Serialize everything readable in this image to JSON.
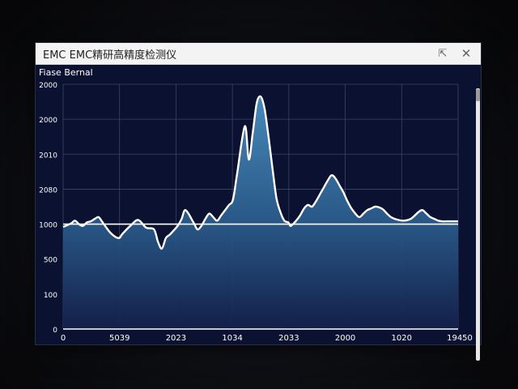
{
  "window": {
    "title": "EMC EMC精研高精度检测仪",
    "restore_glyph": "⇱",
    "close_glyph": "✕"
  },
  "chart_data": {
    "type": "area",
    "title": "Fiase Bernal",
    "xlabel": "",
    "ylabel": "",
    "x_tick_labels": [
      "0",
      "5039",
      "2023",
      "1034",
      "2033",
      "2000",
      "1020",
      "19450"
    ],
    "y_tick_labels": [
      "0",
      "100",
      "500",
      "1000",
      "2080",
      "2010",
      "2000",
      "2000"
    ],
    "ylim": [
      0,
      7
    ],
    "xlim": [
      0,
      100
    ],
    "reference_line": 3,
    "grid": true,
    "colors": {
      "line": "#ffffff",
      "fill_top": "#3f7fb0",
      "fill_bottom": "#13204a",
      "grid": "#3a4468",
      "axis_text": "#ffffff"
    },
    "x": [
      0,
      2,
      3,
      4,
      5,
      6,
      7,
      8,
      9,
      10,
      12,
      14,
      15,
      17,
      19,
      21,
      23,
      24,
      25,
      26,
      27,
      28,
      29,
      30,
      31,
      33,
      34,
      35,
      36,
      37,
      38,
      39,
      40,
      41,
      42,
      43,
      44,
      46,
      47,
      48,
      49,
      50,
      51,
      52,
      53,
      54,
      55,
      56,
      57,
      57.5,
      58,
      59,
      60,
      61,
      62,
      63,
      64,
      65,
      66,
      67,
      68,
      69,
      70,
      71,
      72,
      73,
      74,
      75,
      76,
      77,
      78,
      79,
      80,
      81,
      82,
      83,
      84,
      86,
      88,
      90,
      91,
      92,
      93,
      94,
      95,
      96,
      97,
      98,
      99,
      100
    ],
    "y": [
      2.92,
      3.02,
      3.1,
      3.0,
      2.95,
      3.05,
      3.08,
      3.15,
      3.2,
      3.05,
      2.75,
      2.6,
      2.72,
      2.95,
      3.12,
      2.9,
      2.85,
      2.5,
      2.3,
      2.6,
      2.7,
      2.82,
      2.95,
      3.15,
      3.4,
      3.05,
      2.85,
      2.95,
      3.15,
      3.3,
      3.2,
      3.1,
      3.25,
      3.4,
      3.55,
      3.7,
      4.4,
      5.8,
      4.85,
      5.6,
      6.45,
      6.65,
      6.3,
      5.5,
      4.6,
      3.75,
      3.35,
      3.1,
      3.05,
      2.95,
      2.98,
      3.1,
      3.25,
      3.45,
      3.55,
      3.5,
      3.65,
      3.85,
      4.05,
      4.25,
      4.4,
      4.3,
      4.1,
      3.9,
      3.65,
      3.45,
      3.3,
      3.2,
      3.3,
      3.4,
      3.45,
      3.5,
      3.48,
      3.42,
      3.3,
      3.2,
      3.15,
      3.1,
      3.15,
      3.35,
      3.4,
      3.3,
      3.2,
      3.15,
      3.1,
      3.08,
      3.08,
      3.08,
      3.08,
      3.08
    ]
  }
}
